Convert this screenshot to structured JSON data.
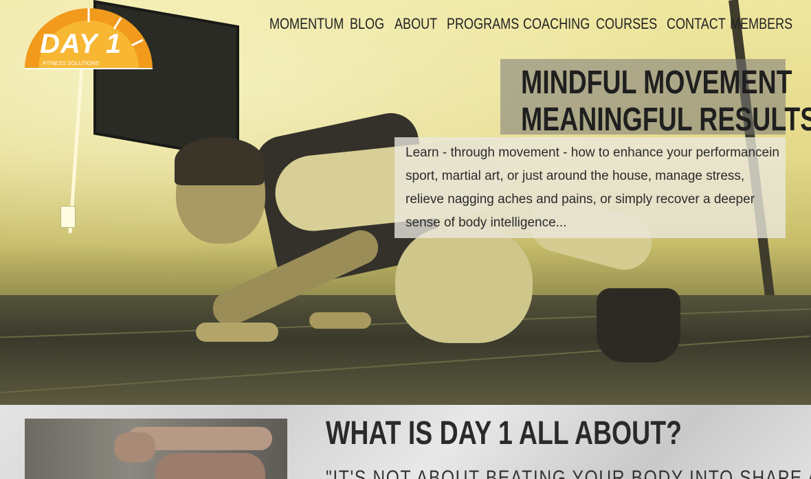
{
  "brand": {
    "name": "DAY 1",
    "tagline": "FITNESS SOLUTIONS",
    "colors": {
      "logo_orange": "#f29a1c",
      "logo_yellow": "#f7b733"
    }
  },
  "nav": {
    "items": [
      {
        "label": "MOMENTUM"
      },
      {
        "label": "BLOG"
      },
      {
        "label": "ABOUT"
      },
      {
        "label": "PROGRAMS"
      },
      {
        "label": "COACHING"
      },
      {
        "label": "COURSES"
      },
      {
        "label": "CONTACT"
      },
      {
        "label": "MEMBERS"
      }
    ]
  },
  "hero": {
    "headline_line1": "MINDFUL MOVEMENT",
    "headline_line2": "MEANINGFUL RESULTS",
    "intro": "Learn - through movement - how to enhance your performancein sport, martial art, or just around the house, manage stress, relieve nagging aches and pains, or simply recover a deeper sense of body intelligence..."
  },
  "about": {
    "title": "WHAT IS DAY 1 ALL ABOUT?",
    "quote": "\"IT'S NOT ABOUT BEATING YOUR BODY INTO SHAPE AND"
  }
}
